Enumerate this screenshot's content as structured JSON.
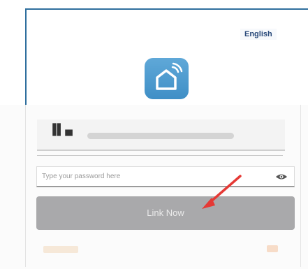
{
  "header": {
    "language_label": "English",
    "logo_icon": "smart-home-icon"
  },
  "form": {
    "wifi_icon": "wifi-signal-icon",
    "password_placeholder": "Type your password here",
    "visibility_icon": "eye-icon",
    "submit_label": "Link Now"
  },
  "colors": {
    "frame_border": "#2f6f9e",
    "logo_bg": "#4a98cf",
    "button_bg": "#a9a9ab",
    "arrow": "#e53935"
  }
}
